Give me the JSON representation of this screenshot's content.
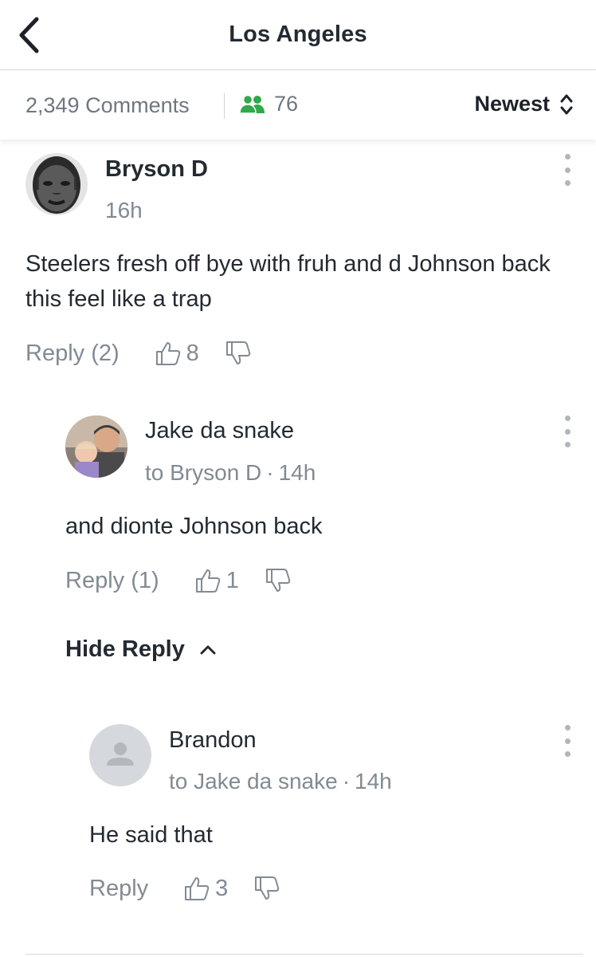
{
  "header": {
    "title": "Los Angeles"
  },
  "stats": {
    "comments": "2,349 Comments",
    "online": "76",
    "sort_label": "Newest"
  },
  "comments": [
    {
      "name": "Bryson D",
      "meta": "16h",
      "body": "Steelers fresh off bye with fruh and d Johnson back this feel like a trap",
      "reply_label": "Reply (2)",
      "likes": "8"
    },
    {
      "name": "Jake da snake",
      "to": "to Bryson D",
      "time": "14h",
      "body": "and dionte Johnson back",
      "reply_label": "Reply (1)",
      "likes": "1"
    },
    {
      "name": "Brandon",
      "to": "to Jake da snake",
      "time": "14h",
      "body": "He said that",
      "reply_label": "Reply",
      "likes": "3"
    }
  ],
  "thread": {
    "hide_reply_label": "Hide Reply"
  },
  "colors": {
    "online_green": "#2fa94b",
    "muted_text": "#828a93",
    "primary_text": "#232a31"
  }
}
